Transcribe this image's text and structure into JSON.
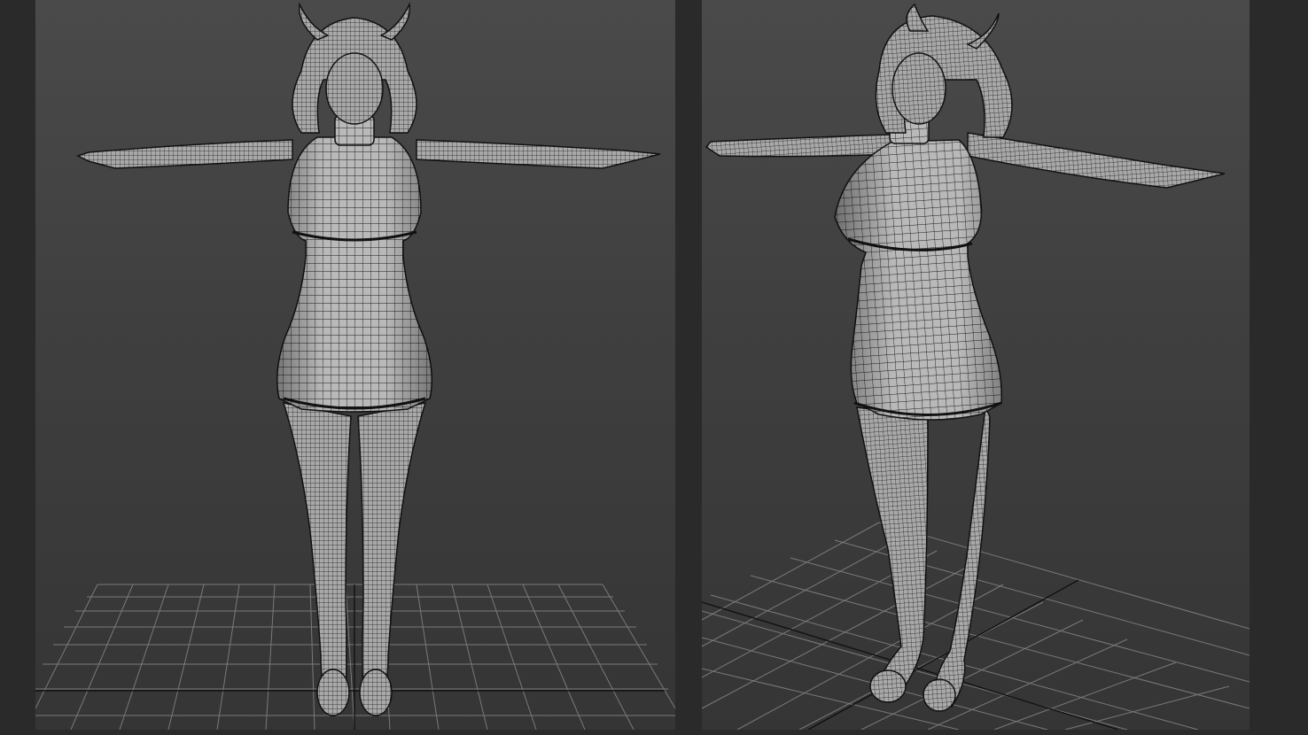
{
  "viewports": [
    {
      "id": "front",
      "view": "front",
      "model": "character-mesh-wireframe",
      "grid": true
    },
    {
      "id": "persp",
      "view": "perspective",
      "model": "character-mesh-wireframe",
      "grid": true
    }
  ],
  "colors": {
    "background": "#2b2b2b",
    "viewport_top": "#4a4a4a",
    "viewport_bottom": "#353535",
    "grid_line": "#7a7a7a",
    "grid_axis": "#111111",
    "mesh_fill": "#b8b8b8",
    "mesh_wire": "#1a1a1a"
  }
}
